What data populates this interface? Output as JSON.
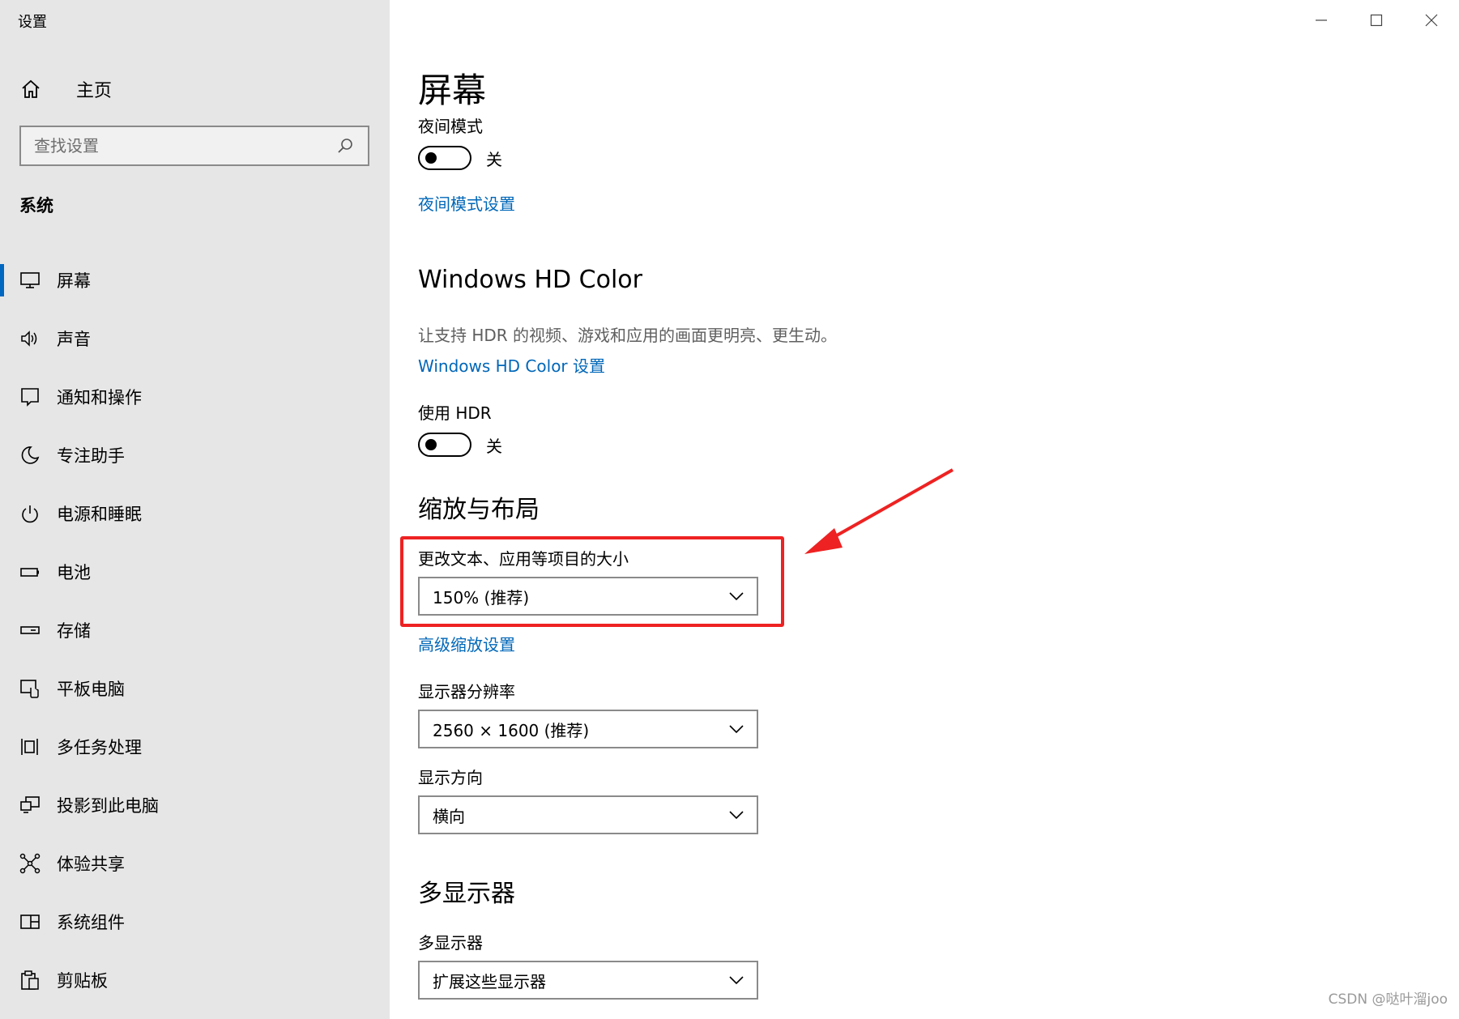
{
  "app": {
    "title": "设置"
  },
  "sidebar": {
    "home_label": "主页",
    "search_placeholder": "查找设置",
    "section_label": "系统",
    "items": [
      {
        "label": "屏幕",
        "icon": "monitor-icon",
        "selected": true
      },
      {
        "label": "声音",
        "icon": "speaker-icon",
        "selected": false
      },
      {
        "label": "通知和操作",
        "icon": "notification-icon",
        "selected": false
      },
      {
        "label": "专注助手",
        "icon": "moon-icon",
        "selected": false
      },
      {
        "label": "电源和睡眠",
        "icon": "power-icon",
        "selected": false
      },
      {
        "label": "电池",
        "icon": "battery-icon",
        "selected": false
      },
      {
        "label": "存储",
        "icon": "storage-icon",
        "selected": false
      },
      {
        "label": "平板电脑",
        "icon": "tablet-icon",
        "selected": false
      },
      {
        "label": "多任务处理",
        "icon": "multitask-icon",
        "selected": false
      },
      {
        "label": "投影到此电脑",
        "icon": "project-icon",
        "selected": false
      },
      {
        "label": "体验共享",
        "icon": "share-icon",
        "selected": false
      },
      {
        "label": "系统组件",
        "icon": "components-icon",
        "selected": false
      },
      {
        "label": "剪贴板",
        "icon": "clipboard-icon",
        "selected": false
      }
    ]
  },
  "main": {
    "title": "屏幕",
    "night_mode": {
      "label": "夜间模式",
      "toggle_state": "关",
      "settings_link": "夜间模式设置"
    },
    "hd_color": {
      "title": "Windows HD Color",
      "description": "让支持 HDR 的视频、游戏和应用的画面更明亮、更生动。",
      "settings_link": "Windows HD Color 设置",
      "hdr_label": "使用 HDR",
      "hdr_state": "关"
    },
    "scale_layout": {
      "title": "缩放与布局",
      "text_size_label": "更改文本、应用等项目的大小",
      "text_size_value": "150% (推荐)",
      "advanced_link": "高级缩放设置",
      "resolution_label": "显示器分辨率",
      "resolution_value": "2560 × 1600 (推荐)",
      "orientation_label": "显示方向",
      "orientation_value": "横向"
    },
    "multi_display": {
      "title": "多显示器",
      "label": "多显示器",
      "value": "扩展这些显示器"
    }
  },
  "watermark": "CSDN @哒叶溜joo",
  "colors": {
    "accent": "#0067c0",
    "link": "#0067b8",
    "annotation": "#ee2222",
    "sidebar_bg": "#e6e6e6"
  }
}
